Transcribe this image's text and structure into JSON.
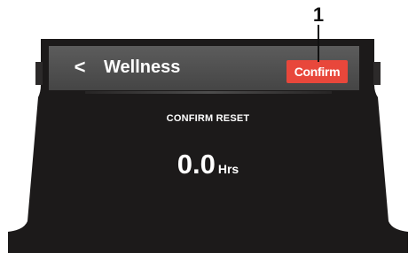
{
  "callout": {
    "number": "1"
  },
  "header": {
    "back_icon": "chevron-left-icon",
    "back_glyph": "<",
    "title": "Wellness",
    "confirm_label": "Confirm"
  },
  "main": {
    "label": "CONFIRM RESET",
    "value": "0.0",
    "unit": "Hrs"
  },
  "colors": {
    "accent": "#e8473b",
    "header_bg": "#4f4f4f",
    "screen_bg": "#1c1a1a"
  }
}
